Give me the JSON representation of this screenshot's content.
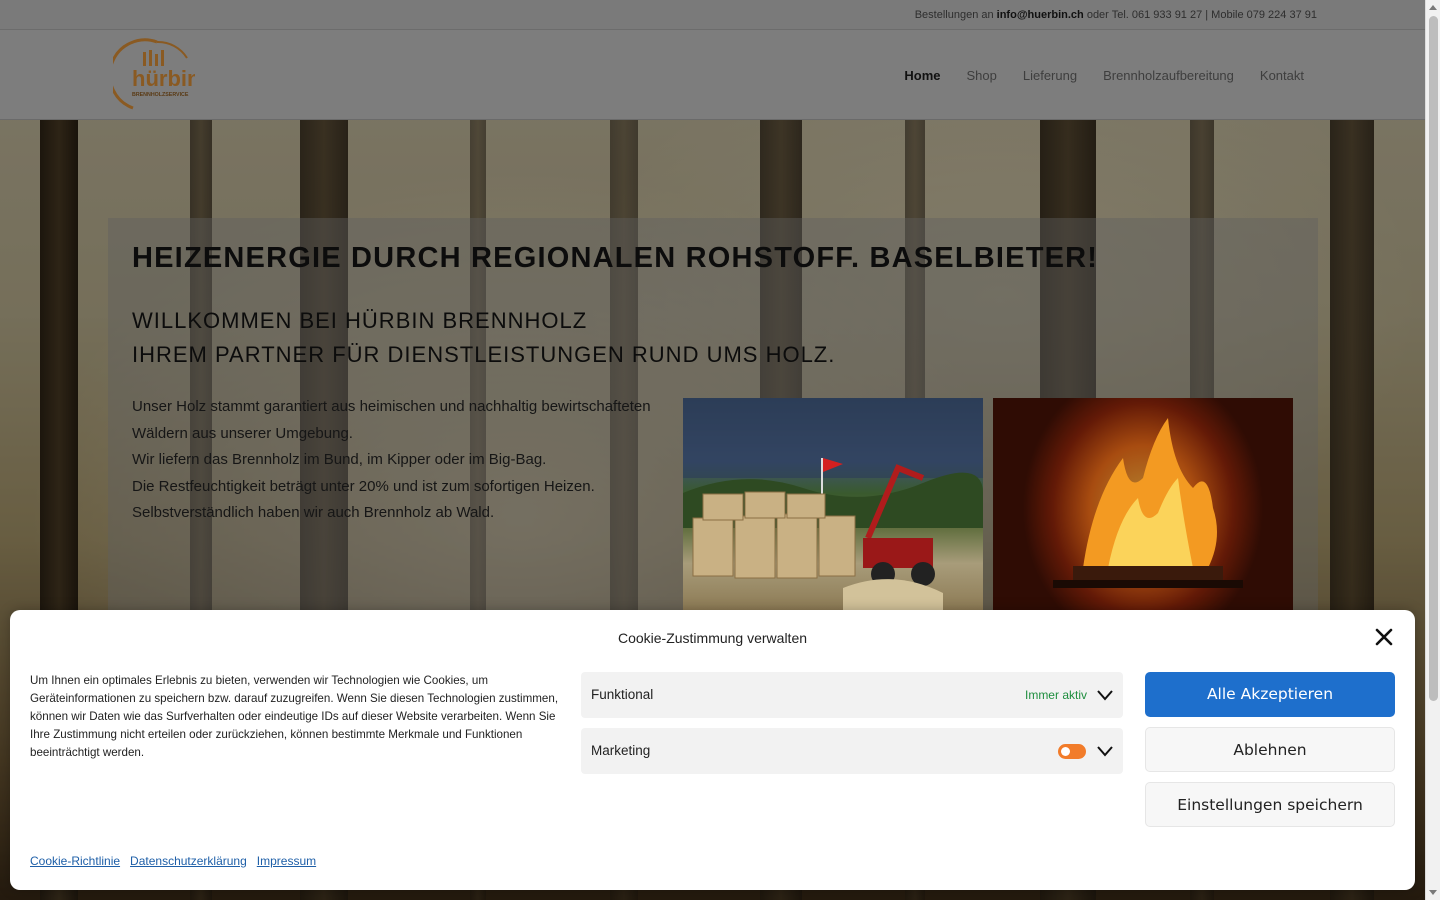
{
  "topbar": {
    "prefix": "Bestellungen an ",
    "email": "info@huerbin.ch",
    "suffix": " oder Tel. 061 933 91 27 | Mobile 079 224 37 91"
  },
  "header": {
    "logo_main": "hürbin",
    "logo_sub": "BRENNHOLZSERVICE",
    "nav": [
      {
        "label": "Home"
      },
      {
        "label": "Shop"
      },
      {
        "label": "Lieferung"
      },
      {
        "label": "Brennholzaufbereitung"
      },
      {
        "label": "Kontakt"
      }
    ]
  },
  "main": {
    "headline": "HEIZENERGIE DURCH REGIONALEN ROHSTOFF. BASELBIETER!",
    "subheadline_1": "WILLKOMMEN BEI HÜRBIN BRENNHOLZ",
    "subheadline_2": "IHREM PARTNER FÜR DIENSTLEISTUNGEN RUND UMS HOLZ.",
    "paragraph": [
      "Unser Holz stammt garantiert aus heimischen und nachhaltig bewirtschafteten",
      "Wäldern aus unserer Umgebung.",
      "Wir liefern das Brennholz im Bund, im Kipper oder im Big-Bag.",
      "Die Restfeuchtigkeit beträgt unter 20% und ist zum sofortigen Heizen.",
      "Selbstverständlich haben wir auch Brennholz ab Wald."
    ]
  },
  "cookie": {
    "title": "Cookie-Zustimmung verwalten",
    "description": "Um Ihnen ein optimales Erlebnis zu bieten, verwenden wir Technologien wie Cookies, um Geräteinformationen zu speichern bzw. darauf zuzugreifen. Wenn Sie diesen Technologien zustimmen, können wir Daten wie das Surfverhalten oder eindeutige IDs auf dieser Website verarbeiten. Wenn Sie Ihre Zustimmung nicht erteilen oder zurückziehen, können bestimmte Merkmale und Funktionen beeinträchtigt werden.",
    "categories": [
      {
        "name": "Funktional",
        "status": "Immer aktiv"
      },
      {
        "name": "Marketing"
      }
    ],
    "buttons": {
      "accept": "Alle Akzeptieren",
      "deny": "Ablehnen",
      "save": "Einstellungen speichern"
    },
    "links": [
      "Cookie-Richtlinie",
      "Datenschutzerklärung",
      "Impressum"
    ]
  },
  "colors": {
    "accent": "#1e6fcc",
    "toggle": "#f27c2a",
    "status_active": "#1e8e3e",
    "logo_brown": "#8a5a22"
  }
}
